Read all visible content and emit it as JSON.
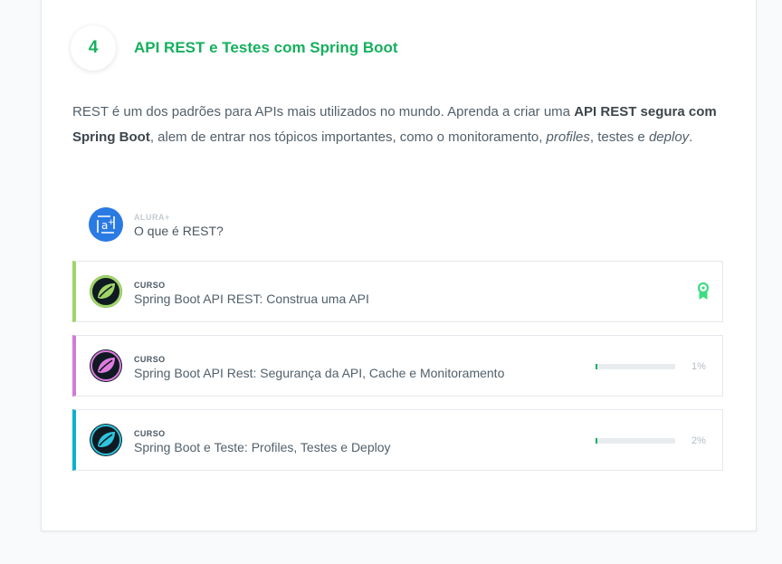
{
  "section": {
    "number": "4",
    "title": "API REST e Testes com Spring Boot",
    "description": {
      "p1": "REST é um dos padrões para APIs mais utilizados no mundo. Aprenda a criar uma ",
      "b1": "API REST segura com Spring Boot",
      "p2": ", alem de entrar nos tópicos importantes, como o monitoramento, ",
      "i1": "profiles",
      "p3": ", testes e ",
      "i2": "deploy",
      "p4": "."
    }
  },
  "alura_item": {
    "kind": "ALURA+",
    "title": "O que é REST?",
    "icon": "alura-plus-icon",
    "color": "#2a7ae4"
  },
  "courses": [
    {
      "kind": "CURSO",
      "title": "Spring Boot API REST: Construa uma API",
      "accent": "#a0d468",
      "icon_color": "#a0d468",
      "status": "completed",
      "badge_icon": "certificate-icon"
    },
    {
      "kind": "CURSO",
      "title": "Spring Boot API Rest: Segurança da API, Cache e Monitoramento",
      "accent": "#d17bd7",
      "icon_color": "#e07be0",
      "progress": 1,
      "progress_label": "1%"
    },
    {
      "kind": "CURSO",
      "title": "Spring Boot e Teste: Profiles, Testes e Deploy",
      "accent": "#09b2cc",
      "icon_color": "#2ec5de",
      "progress": 2,
      "progress_label": "2%"
    }
  ],
  "colors": {
    "green": "#15b05d",
    "text": "#52606b",
    "progress_track": "#e8ecef"
  }
}
